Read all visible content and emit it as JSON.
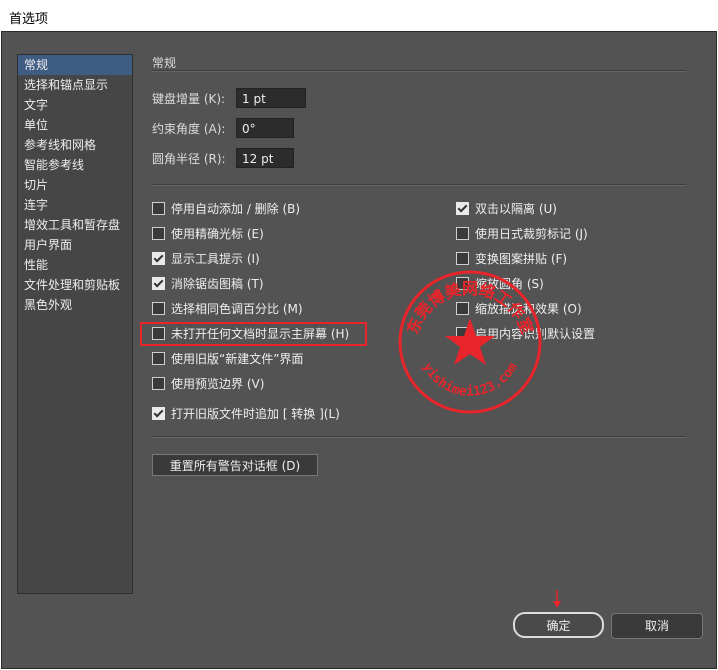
{
  "window": {
    "title": "首选项"
  },
  "sidebar": {
    "items": [
      {
        "label": "常规",
        "active": true
      },
      {
        "label": "选择和锚点显示"
      },
      {
        "label": "文字"
      },
      {
        "label": "单位"
      },
      {
        "label": "参考线和网格"
      },
      {
        "label": "智能参考线"
      },
      {
        "label": "切片"
      },
      {
        "label": "连字"
      },
      {
        "label": "增效工具和暂存盘"
      },
      {
        "label": "用户界面"
      },
      {
        "label": "性能"
      },
      {
        "label": "文件处理和剪贴板"
      },
      {
        "label": "黑色外观"
      }
    ]
  },
  "section": {
    "title": "常规"
  },
  "fields": {
    "keyboard_increment": {
      "label": "键盘增量 (K):",
      "value": "1 pt"
    },
    "constrain_angle": {
      "label": "约束角度 (A):",
      "value": "0°"
    },
    "corner_radius": {
      "label": "圆角半径 (R):",
      "value": "12 pt"
    }
  },
  "left_options": [
    {
      "label": "停用自动添加 / 删除 (B)",
      "checked": false
    },
    {
      "label": "使用精确光标 (E)",
      "checked": false
    },
    {
      "label": "显示工具提示 (I)",
      "checked": true
    },
    {
      "label": "消除锯齿图稿 (T)",
      "checked": true
    },
    {
      "label": "选择相同色调百分比 (M)",
      "checked": false
    },
    {
      "label": "未打开任何文档时显示主屏幕 (H)",
      "checked": false
    },
    {
      "label": "使用旧版“新建文件”界面",
      "checked": false
    },
    {
      "label": "使用预览边界 (V)",
      "checked": false
    }
  ],
  "right_options": [
    {
      "label": "双击以隔离 (U)",
      "checked": true
    },
    {
      "label": "使用日式裁剪标记 (J)",
      "checked": false
    },
    {
      "label": "变换图案拼贴 (F)",
      "checked": false
    },
    {
      "label": "缩放圆角 (S)",
      "checked": false
    },
    {
      "label": "缩放描边和效果 (O)",
      "checked": false
    },
    {
      "label": "启用内容识别默认设置",
      "checked": false
    }
  ],
  "append_option": {
    "label": "打开旧版文件时追加 [ 转换 ](L)",
    "checked": true
  },
  "buttons": {
    "reset_warnings": "重置所有警告对话框 (D)",
    "ok": "确定",
    "cancel": "取消"
  },
  "watermark": {
    "text_top": "东莞博美网络工作室",
    "text_bottom": "yishimei123.com",
    "color": "#e8252a"
  }
}
